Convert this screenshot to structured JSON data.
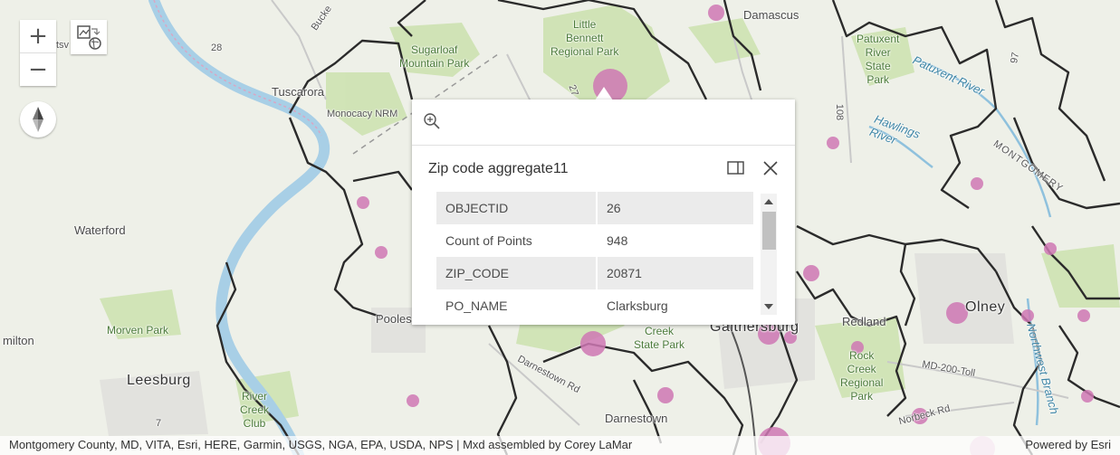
{
  "map": {
    "places": [
      {
        "id": "damascus",
        "label": "Damascus"
      },
      {
        "id": "little-bennett",
        "label": "Little\nBennett\nRegional Park"
      },
      {
        "id": "sugarloaf",
        "label": "Sugarloaf\nMountain Park"
      },
      {
        "id": "patuxent-river-park",
        "label": "Patuxent\nRiver\nState\nPark"
      },
      {
        "id": "patuxent-river",
        "label": "Patuxent River"
      },
      {
        "id": "tuscarora",
        "label": "Tuscarora"
      },
      {
        "id": "monocacy",
        "label": "Monocacy NRM"
      },
      {
        "id": "hawlings-river",
        "label": "Hawlings\nRiver"
      },
      {
        "id": "montgomery",
        "label": "MONTGOMERY"
      },
      {
        "id": "waterford",
        "label": "Waterford"
      },
      {
        "id": "redland",
        "label": "Redland"
      },
      {
        "id": "olney",
        "label": "Olney"
      },
      {
        "id": "morven-park",
        "label": "Morven Park"
      },
      {
        "id": "hamilton",
        "label": "milton"
      },
      {
        "id": "poolesville",
        "label": "Pooles"
      },
      {
        "id": "creek-state-park",
        "label": "Creek\nState Park"
      },
      {
        "id": "gaithersburg",
        "label": "Gaithersburg"
      },
      {
        "id": "rock-creek",
        "label": "Rock\nCreek\nRegional\nPark"
      },
      {
        "id": "leesburg",
        "label": "Leesburg"
      },
      {
        "id": "river-creek-club",
        "label": "River\nCreek\nClub"
      },
      {
        "id": "darnestown",
        "label": "Darnestown"
      },
      {
        "id": "darnestown-rd",
        "label": "Darnestown Rd"
      },
      {
        "id": "northwest-branch",
        "label": "Northwest Branch"
      },
      {
        "id": "md200",
        "label": "MD-200-Toll"
      },
      {
        "id": "norbeck",
        "label": "Norbeck Rd"
      },
      {
        "id": "bucklodge",
        "label": "Bucke"
      },
      {
        "id": "tsv",
        "label": "tsv"
      },
      {
        "id": "r28",
        "label": "28"
      },
      {
        "id": "r27",
        "label": "27"
      },
      {
        "id": "r108",
        "label": "108"
      },
      {
        "id": "r97",
        "label": "97"
      },
      {
        "id": "r7",
        "label": "7"
      }
    ],
    "marker_color": "#cf78b4"
  },
  "controls": {
    "zoom_in": "+",
    "zoom_out": "−"
  },
  "popup": {
    "title": "Zip code aggregate11",
    "fields": [
      {
        "name": "OBJECTID",
        "value": "26"
      },
      {
        "name": "Count of Points",
        "value": "948"
      },
      {
        "name": "ZIP_CODE",
        "value": "20871"
      },
      {
        "name": "PO_NAME",
        "value": "Clarksburg"
      }
    ]
  },
  "attribution": {
    "credits": "Montgomery County, MD, VITA, Esri, HERE, Garmin, USGS, NGA, EPA, USDA, NPS | Mxd assembled by Corey LaMar",
    "powered_by": "Powered by Esri"
  }
}
